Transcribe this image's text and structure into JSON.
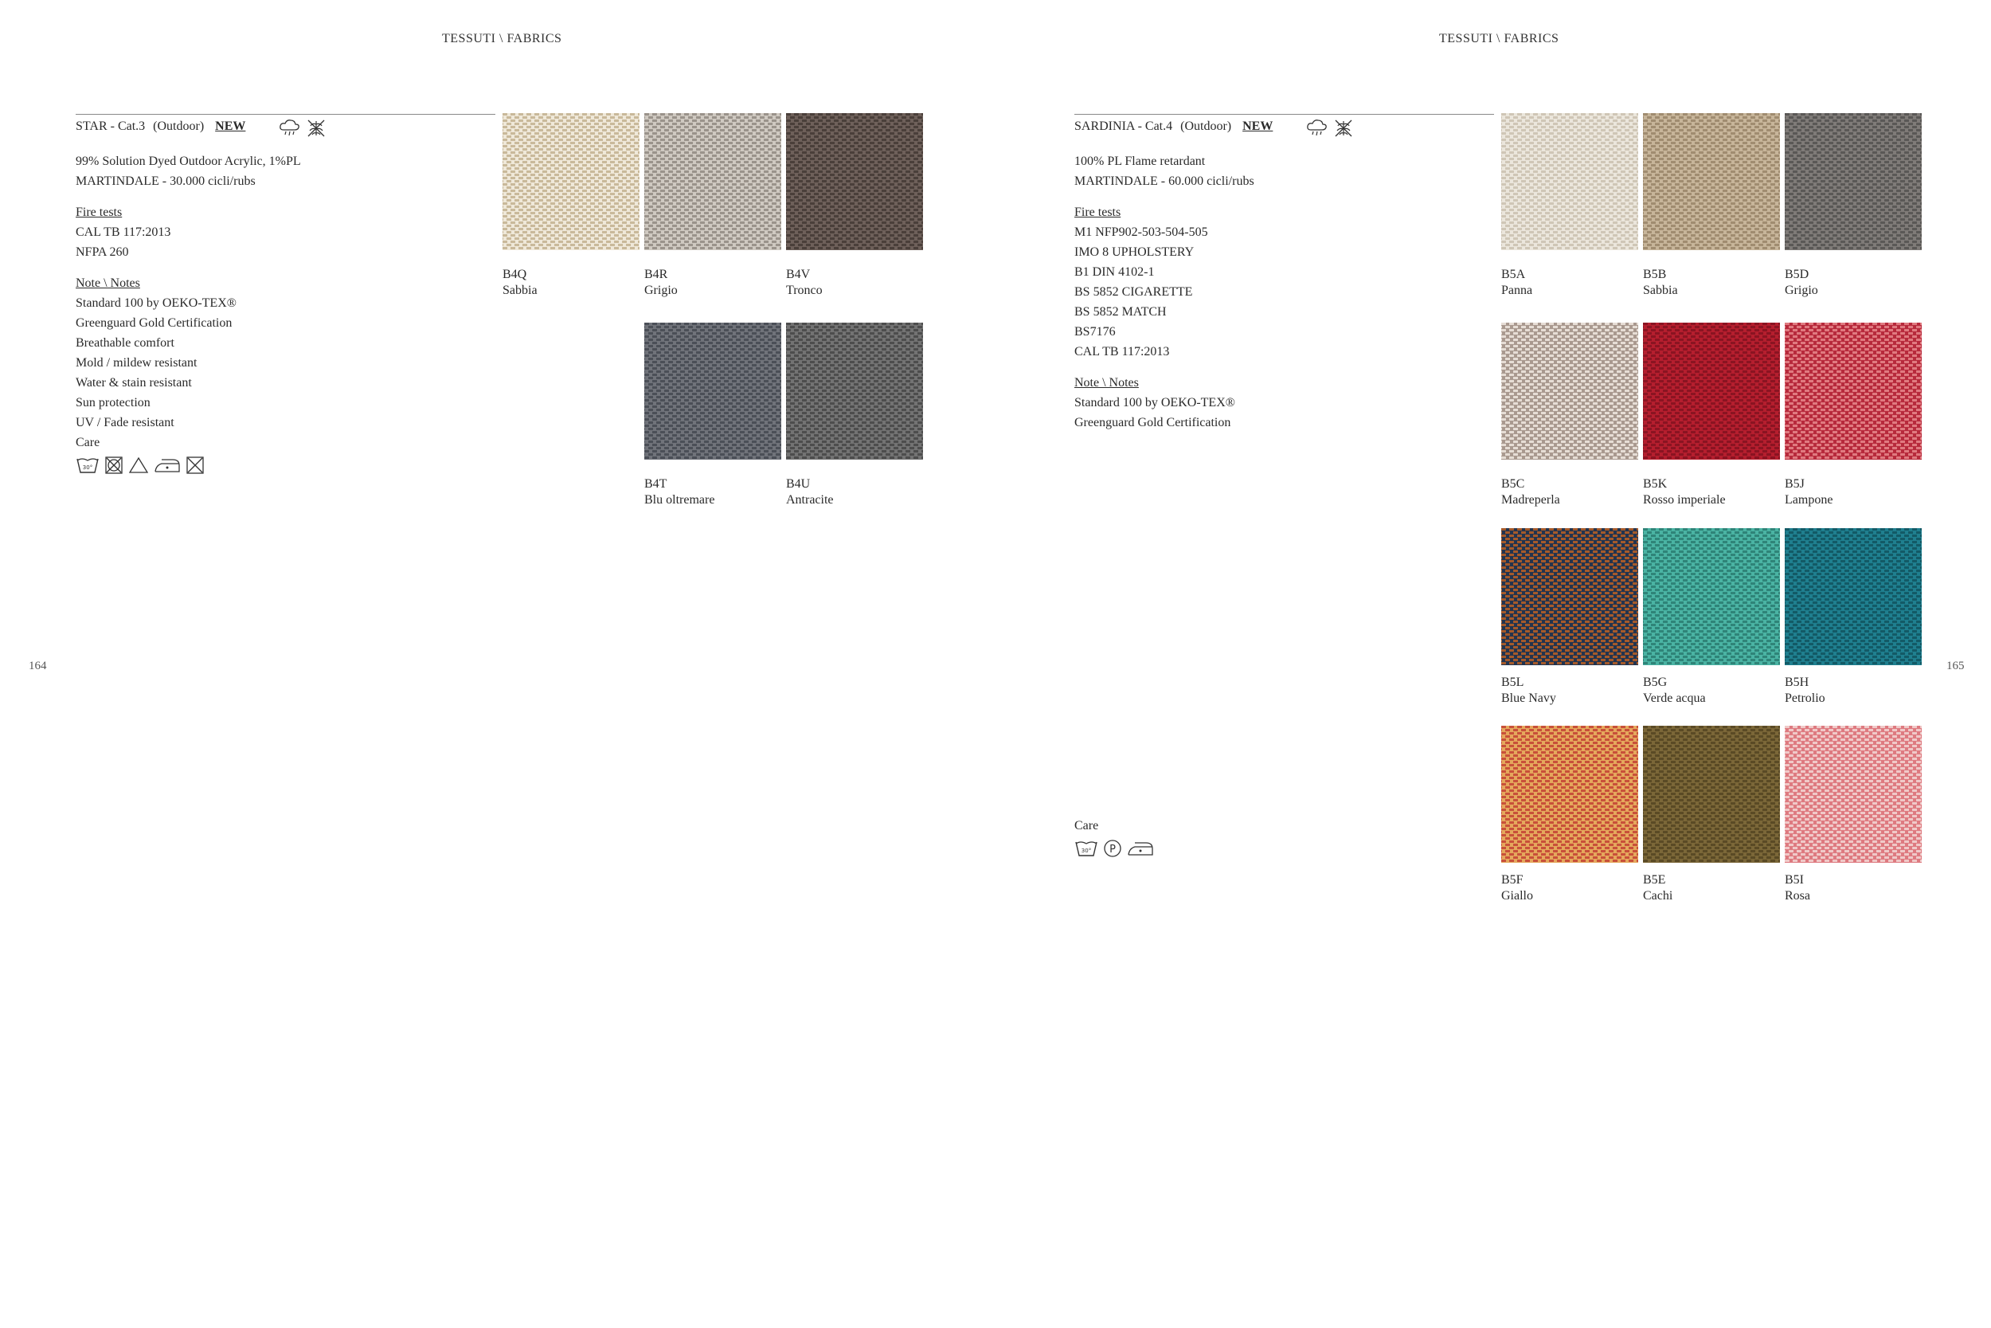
{
  "left": {
    "header": "TESSUTI \\ FABRICS",
    "page_number": "164",
    "fabric": {
      "name": "STAR - Cat.3",
      "category": "(Outdoor)",
      "badge": "NEW",
      "composition": [
        "99% Solution Dyed Outdoor Acrylic, 1%PL",
        "MARTINDALE - 30.000 cicli/rubs"
      ],
      "fire_tests_title": "Fire tests",
      "fire_tests": [
        "CAL TB 117:2013",
        "NFPA 260"
      ],
      "notes_title": "Note \\ Notes",
      "notes": [
        "Standard 100 by OEKO-TEX®",
        "Greenguard Gold Certification",
        "Breathable comfort",
        "Mold / mildew resistant",
        "Water & stain resistant",
        "Sun protection",
        "UV / Fade resistant"
      ],
      "care_title": "Care"
    },
    "swatches": [
      {
        "code": "B4Q",
        "name": "Sabbia",
        "base": "#efe8d9",
        "dot": "#c9b99a"
      },
      {
        "code": "B4R",
        "name": "Grigio",
        "base": "#cfc9c1",
        "dot": "#9a938b"
      },
      {
        "code": "B4V",
        "name": "Tronco",
        "base": "#6e605a",
        "dot": "#4a3f3a"
      },
      {
        "code": "B4T",
        "name": "Blu oltremare",
        "base": "#70737a",
        "dot": "#4b4f57"
      },
      {
        "code": "B4U",
        "name": "Antracite",
        "base": "#737373",
        "dot": "#4d4d4d"
      }
    ]
  },
  "right": {
    "header": "TESSUTI \\ FABRICS",
    "page_number": "165",
    "fabric": {
      "name": "SARDINIA - Cat.4",
      "category": "(Outdoor)",
      "badge": "NEW",
      "composition": [
        "100% PL Flame retardant",
        "MARTINDALE - 60.000 cicli/rubs"
      ],
      "fire_tests_title": "Fire tests",
      "fire_tests": [
        "M1 NFP902-503-504-505",
        "IMO 8 UPHOLSTERY",
        "B1 DIN 4102-1",
        "BS 5852 CIGARETTE",
        "BS 5852 MATCH",
        "BS7176",
        "CAL TB 117:2013"
      ],
      "notes_title": "Note \\ Notes",
      "notes": [
        "Standard 100 by OEKO-TEX®",
        "Greenguard Gold Certification"
      ],
      "care_title": "Care"
    },
    "swatches": [
      {
        "code": "B5A",
        "name": "Panna",
        "base": "#ebe6dc",
        "dot": "#cfc6b6"
      },
      {
        "code": "B5B",
        "name": "Sabbia",
        "base": "#c7b59a",
        "dot": "#a08c70"
      },
      {
        "code": "B5D",
        "name": "Grigio",
        "base": "#7f7b78",
        "dot": "#5a5856"
      },
      {
        "code": "B5C",
        "name": "Madreperla",
        "base": "#a9998f",
        "dot": "#e6ddd5"
      },
      {
        "code": "B5K",
        "name": "Rosso imperiale",
        "base": "#b51e2e",
        "dot": "#8a1422"
      },
      {
        "code": "B5J",
        "name": "Lampone",
        "base": "#b72a3c",
        "dot": "#e07a80"
      },
      {
        "code": "B5L",
        "name": "Blue Navy",
        "base": "#22344f",
        "dot": "#a65a2a"
      },
      {
        "code": "B5G",
        "name": "Verde acqua",
        "base": "#4ab3a3",
        "dot": "#2f8478"
      },
      {
        "code": "B5H",
        "name": "Petrolio",
        "base": "#1f7f8f",
        "dot": "#135a66"
      },
      {
        "code": "B5F",
        "name": "Giallo",
        "base": "#e5a85c",
        "dot": "#c8503a"
      },
      {
        "code": "B5E",
        "name": "Cachi",
        "base": "#7b6738",
        "dot": "#5a4a25"
      },
      {
        "code": "B5I",
        "name": "Rosa",
        "base": "#de7a80",
        "dot": "#f0c9c8"
      }
    ]
  }
}
